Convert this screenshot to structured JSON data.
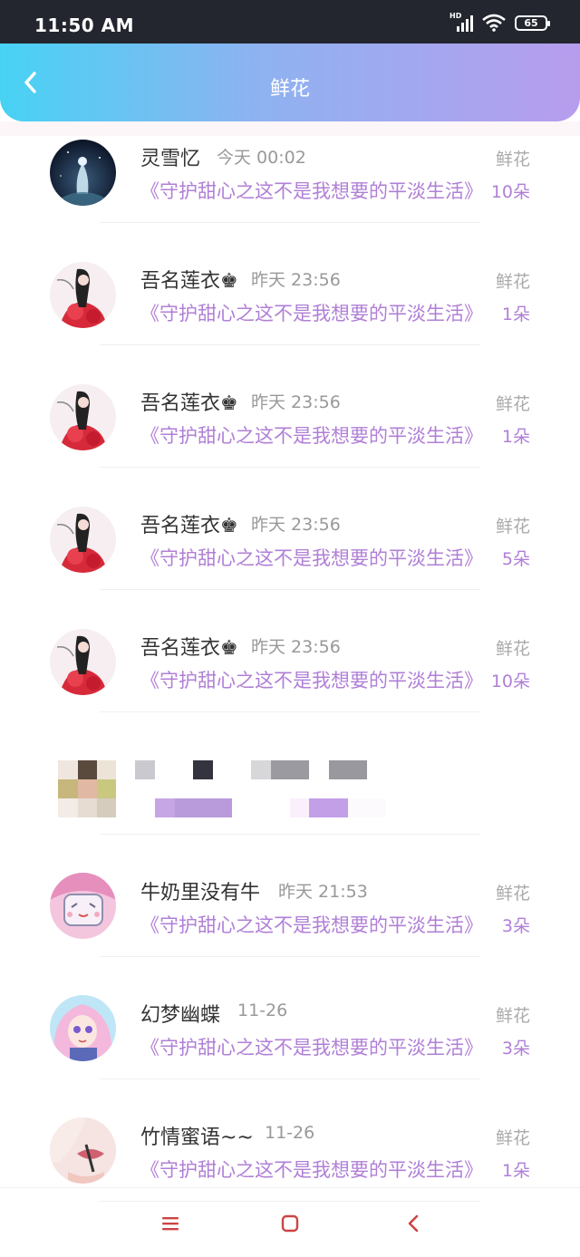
{
  "status_bar": {
    "time": "11:50 AM",
    "network": "HD",
    "battery": "65"
  },
  "header": {
    "title": "鲜花",
    "back_icon": "chevron-left-icon"
  },
  "colors": {
    "accent_purple": "#b07fd6",
    "gradient_start": "#47d2f4",
    "gradient_end": "#b79ded"
  },
  "rows": [
    {
      "name": "灵雪忆",
      "time": "今天 00:02",
      "message": "《守护甜心之这不是我想要的平淡生活》",
      "type": "鲜花",
      "count": "10朵"
    },
    {
      "name": "吾名莲衣♚",
      "time": "昨天 23:56",
      "message": "《守护甜心之这不是我想要的平淡生活》",
      "type": "鲜花",
      "count": "1朵"
    },
    {
      "name": "吾名莲衣♚",
      "time": "昨天 23:56",
      "message": "《守护甜心之这不是我想要的平淡生活》",
      "type": "鲜花",
      "count": "1朵"
    },
    {
      "name": "吾名莲衣♚",
      "time": "昨天 23:56",
      "message": "《守护甜心之这不是我想要的平淡生活》",
      "type": "鲜花",
      "count": "5朵"
    },
    {
      "name": "吾名莲衣♚",
      "time": "昨天 23:56",
      "message": "《守护甜心之这不是我想要的平淡生活》",
      "type": "鲜花",
      "count": "10朵"
    },
    {
      "name": "",
      "time": "",
      "message": "",
      "type": "",
      "count": ""
    },
    {
      "name": "牛奶里没有牛",
      "time": "昨天 21:53",
      "message": "《守护甜心之这不是我想要的平淡生活》",
      "type": "鲜花",
      "count": "3朵"
    },
    {
      "name": "幻梦幽蝶",
      "time": "11-26",
      "message": "《守护甜心之这不是我想要的平淡生活》",
      "type": "鲜花",
      "count": "3朵"
    },
    {
      "name": "竹情蜜语~~",
      "time": "11-26",
      "message": "《守护甜心之这不是我想要的平淡生活》",
      "type": "鲜花",
      "count": "1朵"
    }
  ],
  "navbar": {
    "menu_icon": "menu-icon",
    "home_icon": "home-square-icon",
    "back_icon": "back-triangle-icon"
  }
}
